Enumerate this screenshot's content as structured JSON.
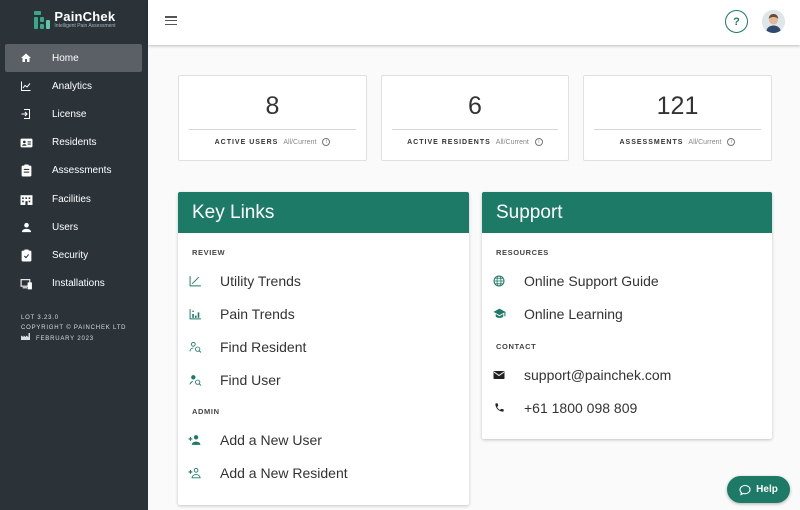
{
  "app": {
    "logo_name": "PainChek",
    "logo_tagline": "Intelligent Pain Assessment",
    "brand_color": "#1c7a66",
    "sidebar_bg": "#2b3339"
  },
  "sidebar": {
    "items": [
      {
        "label": "Home",
        "icon": "home-icon",
        "active": true
      },
      {
        "label": "Analytics",
        "icon": "analytics-icon",
        "active": false
      },
      {
        "label": "License",
        "icon": "license-icon",
        "active": false
      },
      {
        "label": "Residents",
        "icon": "residents-icon",
        "active": false
      },
      {
        "label": "Assessments",
        "icon": "assessments-icon",
        "active": false
      },
      {
        "label": "Facilities",
        "icon": "facilities-icon",
        "active": false
      },
      {
        "label": "Users",
        "icon": "users-icon",
        "active": false
      },
      {
        "label": "Security",
        "icon": "security-icon",
        "active": false
      },
      {
        "label": "Installations",
        "icon": "installations-icon",
        "active": false
      }
    ],
    "version": "LOT 3.23.0",
    "copyright": "COPYRIGHT © PAINCHEK LTD",
    "release": "FEBRUARY 2023"
  },
  "topbar": {
    "help_label": "?"
  },
  "stats": [
    {
      "value": "8",
      "label": "ACTIVE USERS",
      "sub": "All/Current"
    },
    {
      "value": "6",
      "label": "ACTIVE RESIDENTS",
      "sub": "All/Current"
    },
    {
      "value": "121",
      "label": "ASSESSMENTS",
      "sub": "All/Current"
    }
  ],
  "key_links": {
    "title": "Key Links",
    "review_heading": "REVIEW",
    "review": [
      {
        "label": "Utility Trends",
        "icon": "trend-icon"
      },
      {
        "label": "Pain Trends",
        "icon": "bar-chart-icon"
      },
      {
        "label": "Find Resident",
        "icon": "find-person-icon"
      },
      {
        "label": "Find User",
        "icon": "find-user-icon"
      }
    ],
    "admin_heading": "ADMIN",
    "admin": [
      {
        "label": "Add a New User",
        "icon": "add-user-icon"
      },
      {
        "label": "Add a New Resident",
        "icon": "add-resident-icon"
      }
    ]
  },
  "support": {
    "title": "Support",
    "resources_heading": "RESOURCES",
    "resources": [
      {
        "label": "Online Support Guide",
        "icon": "globe-icon"
      },
      {
        "label": "Online Learning",
        "icon": "graduation-cap-icon"
      }
    ],
    "contact_heading": "CONTACT",
    "contact": [
      {
        "label": "support@painchek.com",
        "icon": "mail-icon"
      },
      {
        "label": "+61 1800 098 809",
        "icon": "phone-icon"
      }
    ]
  },
  "help_button": {
    "label": "Help"
  }
}
